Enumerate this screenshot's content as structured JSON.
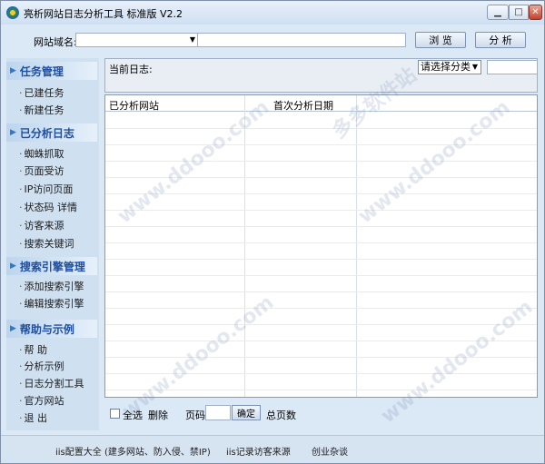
{
  "window": {
    "title": "亮析网站日志分析工具 标准版 V2.2"
  },
  "toolbar": {
    "domain_label": "网站域名:",
    "domain_value": "",
    "url_value": "",
    "browse_label": "浏 览",
    "analyze_label": "分 析"
  },
  "sidebar": {
    "sections": [
      {
        "title": "任务管理",
        "items": [
          "已建任务",
          "新建任务"
        ]
      },
      {
        "title": "已分析日志",
        "items": [
          "蜘蛛抓取",
          "页面受访",
          "IP访问页面",
          "状态码  详情",
          "访客来源",
          "搜索关键词"
        ]
      },
      {
        "title": "搜索引擎管理",
        "items": [
          "添加搜索引擎",
          "编辑搜索引擎"
        ]
      },
      {
        "title": "帮助与示例",
        "items": [
          "帮  助",
          "分析示例",
          "日志分割工具",
          "官方网站",
          "退  出"
        ]
      }
    ]
  },
  "logbar": {
    "label": "当前日志:",
    "category_select": "请选择分类"
  },
  "table": {
    "headers": [
      "已分析网站",
      "首次分析日期"
    ]
  },
  "footer": {
    "select_all": "全选",
    "delete": "删除",
    "page_label": "页码",
    "ok": "确定",
    "total_pages": "总页数"
  },
  "statusbar": {
    "links": [
      "iis配置大全 (建多网站、防入侵、禁IP)",
      "iis记录访客来源",
      "创业杂谈"
    ]
  },
  "watermark": [
    "多多软件站",
    "www.ddooo.com"
  ],
  "colors": {
    "accent": "#1f4fa0",
    "window_bg": "#dbe8f5",
    "nav_bg": "#cfe0f1"
  }
}
